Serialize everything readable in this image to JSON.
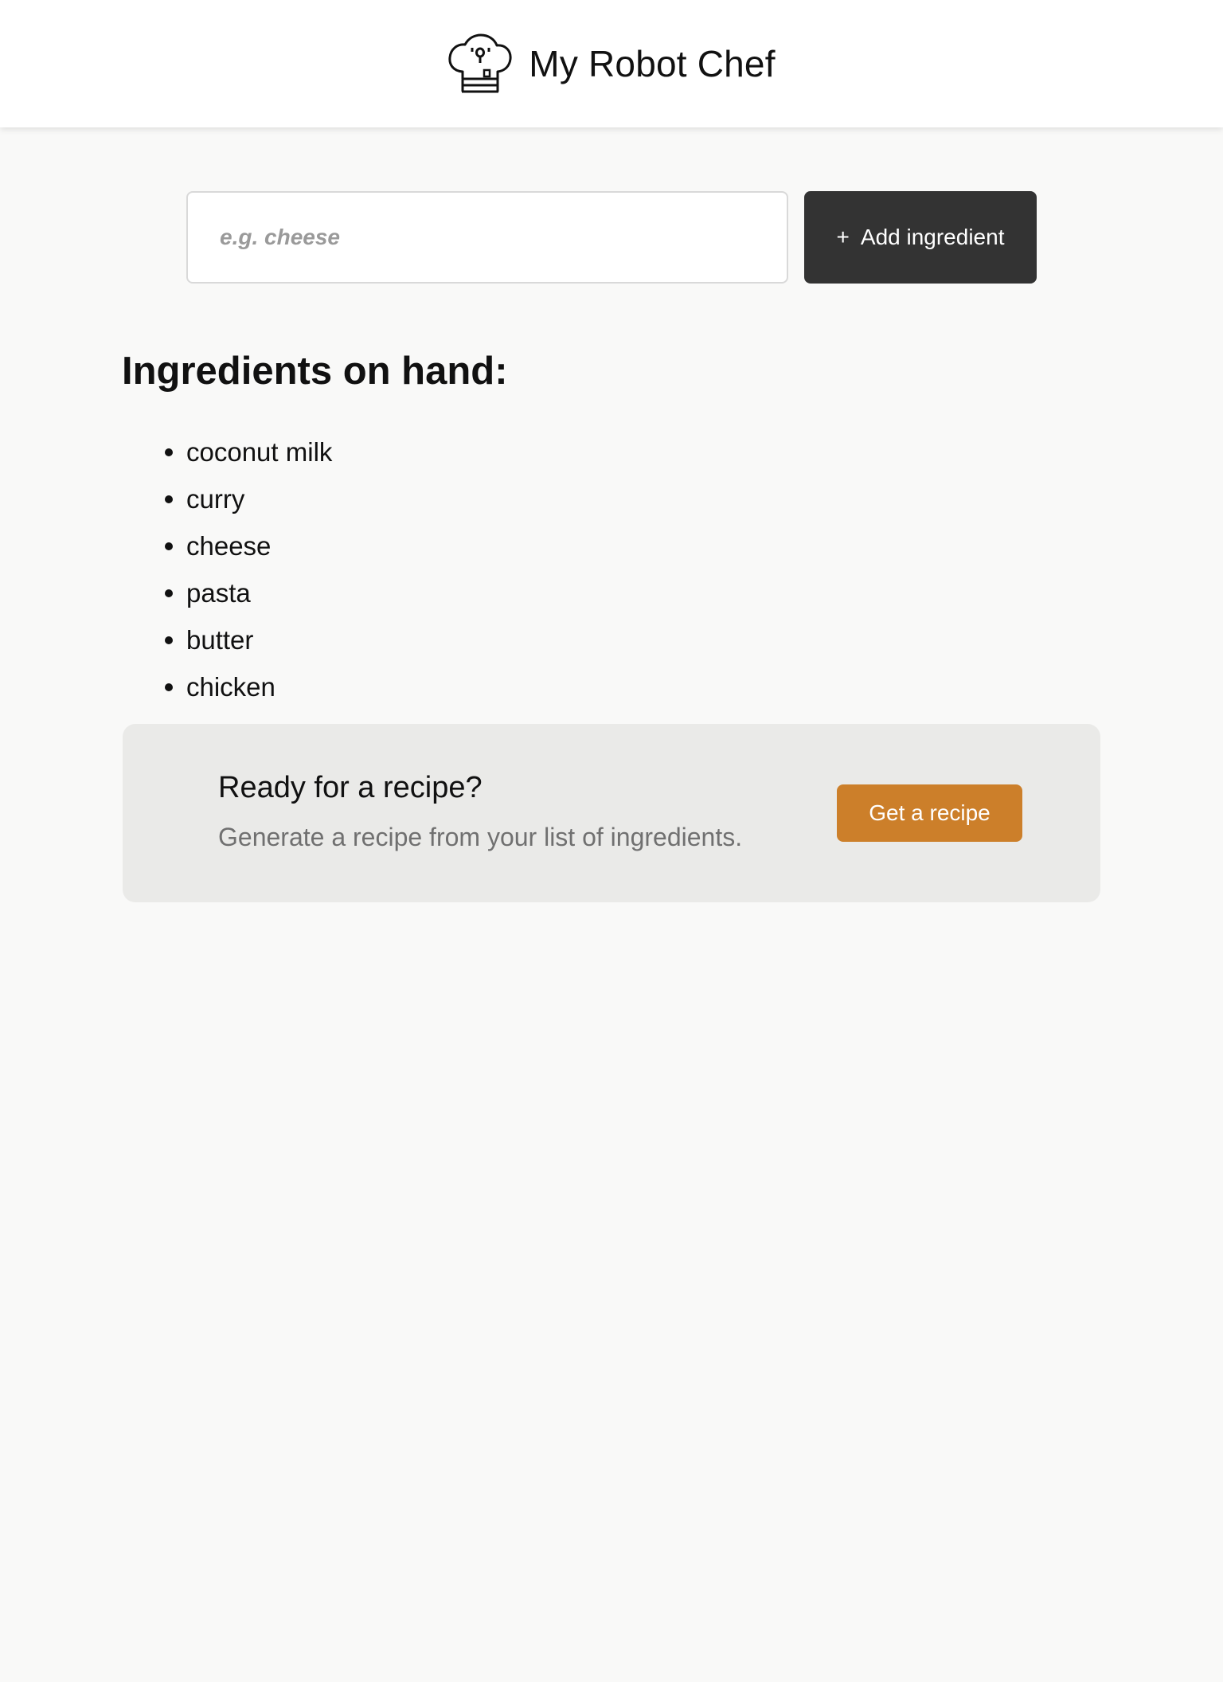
{
  "header": {
    "title": "My Robot Chef",
    "logo_icon": "chef-hat-icon"
  },
  "ingredient_form": {
    "placeholder": "e.g. cheese",
    "value": "",
    "add_icon": "plus-icon",
    "add_icon_glyph": "+",
    "add_label": "Add ingredient"
  },
  "ingredients": {
    "heading": "Ingredients on hand:",
    "items": [
      "coconut milk",
      "curry",
      "cheese",
      "pasta",
      "butter",
      "chicken"
    ]
  },
  "recipe_panel": {
    "title": "Ready for a recipe?",
    "subtitle": "Generate a recipe from your list of ingredients.",
    "button_label": "Get a recipe"
  },
  "colors": {
    "page_background": "#f9f9f8",
    "header_background": "#ffffff",
    "add_button": "#333333",
    "recipe_panel": "#eaeae8",
    "recipe_button": "#cc7f2a",
    "subtitle_text": "#707070"
  }
}
